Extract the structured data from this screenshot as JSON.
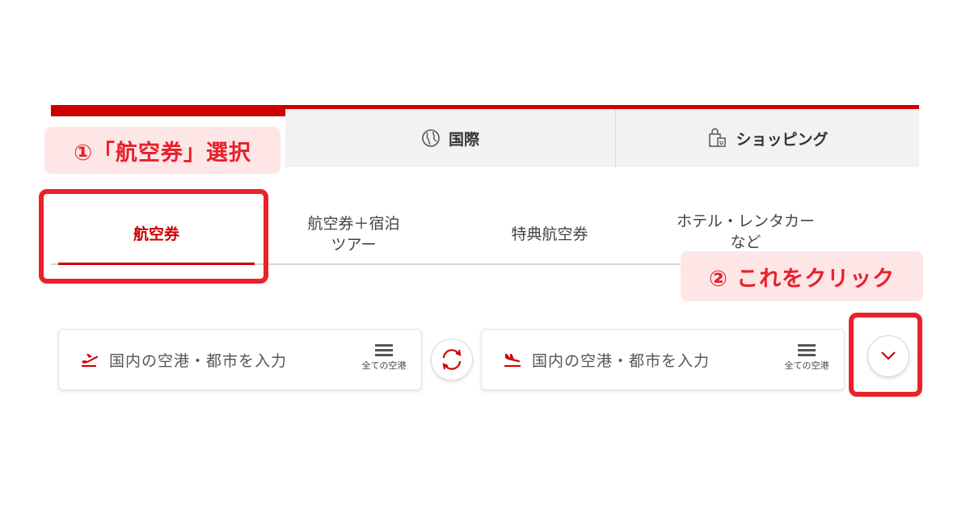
{
  "top_tabs": {
    "domestic": {
      "label": ""
    },
    "international": {
      "label": "国際",
      "icon": "globe-icon"
    },
    "shopping": {
      "label": "ショッピング",
      "icon": "shopping-bag-icon"
    }
  },
  "annotations": {
    "step1": "①「航空券」選択",
    "step2": "② これをクリック"
  },
  "sub_tabs": [
    {
      "label": "航空券",
      "active": true
    },
    {
      "label": "航空券＋宿泊\nツアー",
      "active": false
    },
    {
      "label": "特典航空券",
      "active": false
    },
    {
      "label": "ホテル・レンタカー\nなど",
      "active": false
    }
  ],
  "search": {
    "departure": {
      "placeholder": "国内の空港・都市を入力",
      "icon": "plane-takeoff-icon",
      "list_label": "全ての空港"
    },
    "arrival": {
      "placeholder": "国内の空港・都市を入力",
      "icon": "plane-landing-icon",
      "list_label": "全ての空港"
    },
    "swap_icon": "swap-icon",
    "expand_icon": "chevron-down-icon"
  },
  "colors": {
    "accent": "#cc0000",
    "highlight": "#ea2228",
    "note_bg": "#ffe6e6",
    "note_text": "#e8202a"
  }
}
